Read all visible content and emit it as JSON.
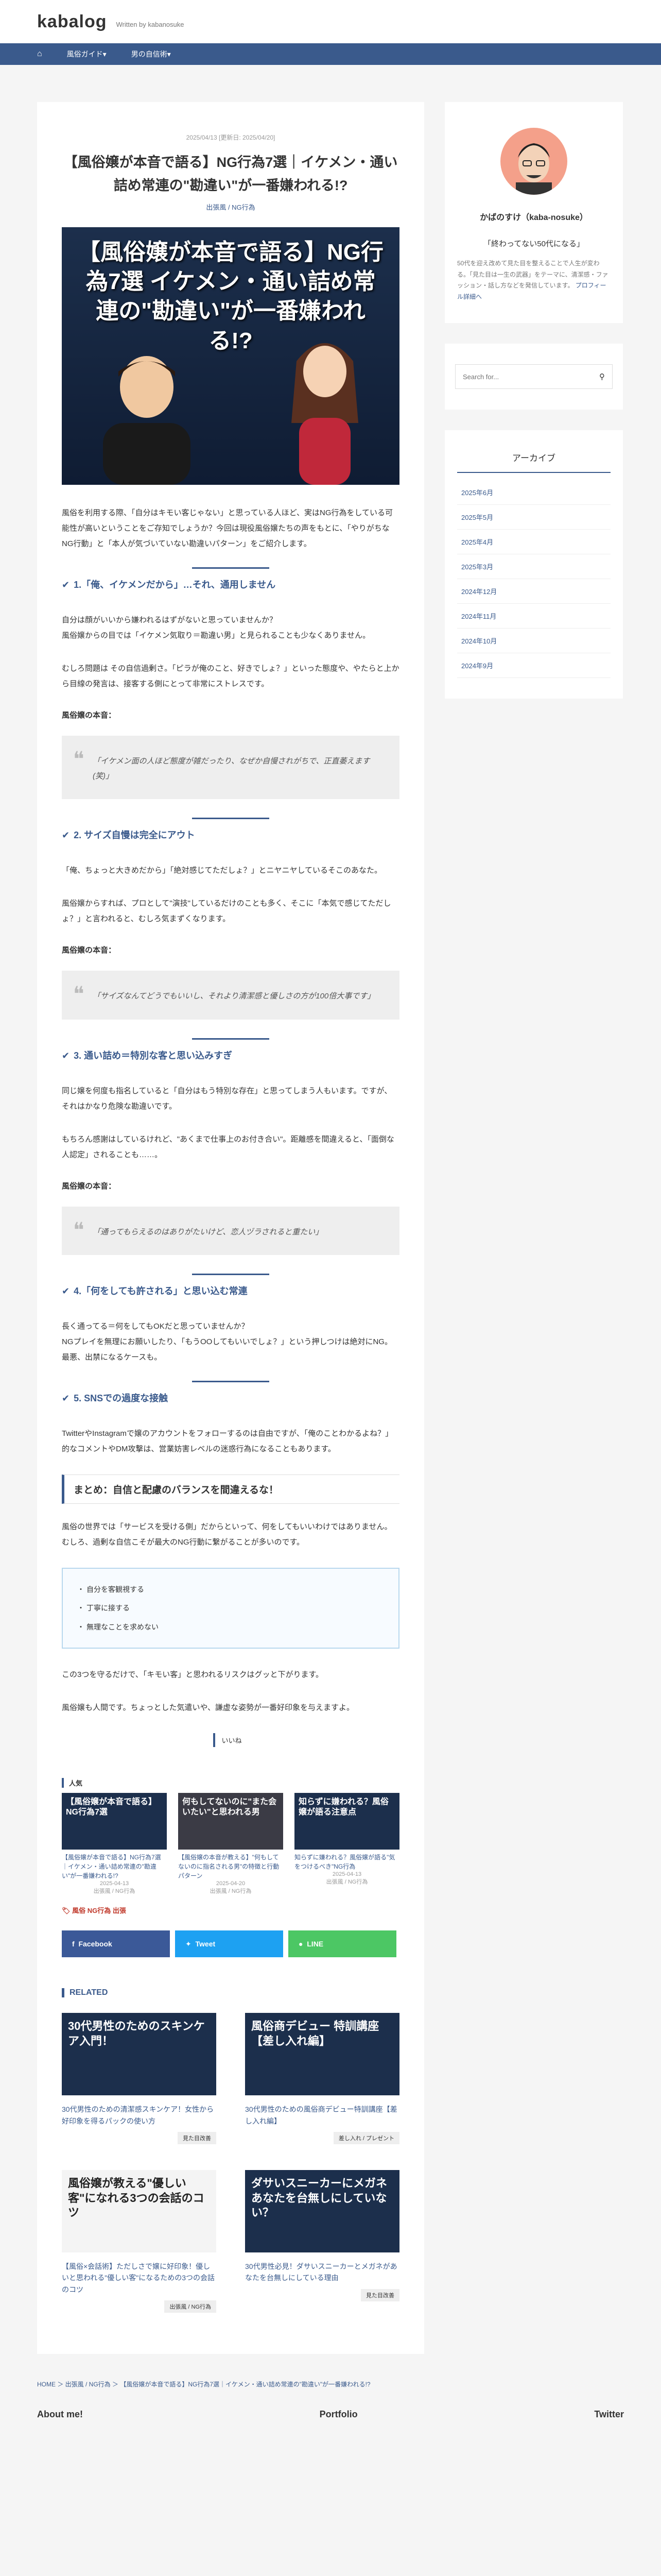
{
  "site": {
    "logo": "kabalog",
    "tagline": "Written by kabanosuke"
  },
  "nav": {
    "home_icon": "home-icon",
    "items": [
      "風俗ガイド▾",
      "男の自信術▾"
    ]
  },
  "article": {
    "meta": "2025/04/13 [更新日: 2025/04/20]",
    "title": "【風俗嬢が本音で語る】NG行為7選｜イケメン・通い詰め常連の\"勘違い\"が一番嫌われる!?",
    "category": "出張風 / NG行為",
    "eyecatch_title": "【風俗嬢が本音で語る】NG行為7選 イケメン・通い詰め常連の\"勘違い\"が一番嫌われる!?",
    "intro": "風俗を利用する際、「自分はキモい客じゃない」と思っている人ほど、実はNG行為をしている可能性が高いということをご存知でしょうか？今回は現役風俗嬢たちの声をもとに、「やりがちなNG行動」と「本人が気づいていない勘違いパターン」をご紹介します。",
    "sections": [
      {
        "heading": "1.「俺、イケメンだから」…それ、通用しません",
        "body1": "自分は顔がいいから嫌われるはずがないと思っていませんか？\n風俗嬢からの目では「イケメン気取り＝勘違い男」と見られることも少なくありません。",
        "body2": "むしろ問題は その自信過剰さ。「ピラが俺のこと、好きでしょ？」といった態度や、やたらと上から目線の発言は、接客する側にとって非常にストレスです。",
        "honne_label": "風俗嬢の本音：",
        "quote": "「イケメン面の人ほど態度が雑だったり、なぜか自慢されがちで、正直萎えます(笑)」"
      },
      {
        "heading": "2. サイズ自慢は完全にアウト",
        "body1": "「俺、ちょっと大きめだから」「絶対感じてただしょ？」とニヤニヤしているそこのあなた。",
        "body2": "風俗嬢からすれば、プロとして\"演技\"しているだけのことも多く、そこに「本気で感じてただしょ？」と言われると、むしろ気まずくなります。",
        "honne_label": "風俗嬢の本音：",
        "quote": "「サイズなんてどうでもいいし、それより清潔感と優しさの方が100倍大事です」"
      },
      {
        "heading": "3. 通い詰め＝特別な客と思い込みすぎ",
        "body1": "同じ嬢を何度も指名していると「自分はもう特別な存在」と思ってしまう人もいます。ですが、それはかなり危険な勘違いです。",
        "body2": "もちろん感謝はしているけれど、\"あくまで仕事上のお付き合い\"。距離感を間違えると、「面倒な人認定」されることも……。",
        "honne_label": "風俗嬢の本音：",
        "quote": "「通ってもらえるのはありがたいけど、恋人ヅラされると重たい」"
      },
      {
        "heading": "4.「何をしても許される」と思い込む常連",
        "body1": "長く通ってる＝何をしてもOKだと思っていませんか？\nNGプレイを無理にお願いしたり、「もうOOしてもいいでしょ？」という押しつけは絶対にNG。最悪、出禁になるケースも。"
      },
      {
        "heading": "5. SNSでの過度な接触",
        "body1": "TwitterやInstagramで嬢のアカウントをフォローするのは自由ですが、「俺のことわかるよね？」的なコメントやDM攻撃は、営業妨害レベルの迷惑行為になることもあります。"
      }
    ],
    "matome": {
      "heading": "まとめ：自信と配慮のバランスを間違えるな！",
      "body1": "風俗の世界では「サービスを受ける側」だからといって、何をしてもいいわけではありません。\nむしろ、過剰な自信こそが最大のNG行動に繋がることが多いのです。",
      "list": [
        "自分を客観視する",
        "丁寧に接する",
        "無理なことを求めない"
      ],
      "body2": "この3つを守るだけで、「キモい客」と思われるリスクはグッと下がります。",
      "body3": "風俗嬢も人間です。ちょっとした気遣いや、謙虚な姿勢が一番好印象を与えますよ。"
    },
    "iine": "いいね",
    "popular_head": "人気",
    "popular": [
      {
        "thumb": "【風俗嬢が本音で語る】NG行為7選",
        "title": "【風俗嬢が本音で語る】NG行為7選｜イケメン・通い詰め常連の\"勘違い\"が一番嫌われる!?",
        "date": "2025-04-13",
        "cat": "出張風 / NG行為"
      },
      {
        "thumb": "何もしてないのに\"また会いたい\"と思われる男",
        "title": "【風俗嬢の本音が教える】\"何もしてないのに指名される男\"の特徴と行動パターン",
        "date": "2025-04-20",
        "cat": "出張風 / NG行為"
      },
      {
        "thumb": "知らずに嫌われる？風俗嬢が語る注意点",
        "title": "知らずに嫌われる？風俗嬢が語る\"気をつけるべき\"NG行為",
        "date": "2025-04-13",
        "cat": "出張風 / NG行為"
      }
    ],
    "tag": "風俗 NG行為 出張",
    "share": [
      {
        "label": "Facebook",
        "color": "#3b5998"
      },
      {
        "label": "Tweet",
        "color": "#1da1f2"
      },
      {
        "label": "LINE",
        "color": "#4cc764"
      }
    ],
    "related_head": "RELATED",
    "related": [
      {
        "thumb": "30代男性のためのスキンケア入門！",
        "title": "30代男性のための清潔感スキンケア！女性から好印象を得るパックの使い方",
        "cat": "見た目改善"
      },
      {
        "thumb": "風俗商デビュー 特訓講座【差し入れ編】",
        "title": "30代男性のための風俗商デビュー特訓講座【差し入れ編】",
        "cat": "差し入れ / プレゼント"
      },
      {
        "thumb": "風俗嬢が教える\"優しい客\"になれる3つの会話のコツ",
        "title": "【風俗×会話術】ただしさで嬢に好印象！優しいと思われる\"優しい客\"になるための3つの会話のコツ",
        "cat": "出張風 / NG行為"
      },
      {
        "thumb": "ダサいスニーカーにメガネあなたを台無しにしていない？",
        "title": "30代男性必見！ダサいスニーカーとメガネがあなたを台無しにしている理由",
        "cat": "見た目改善"
      }
    ]
  },
  "sidebar": {
    "name": "かばのすけ（kaba-nosuke）",
    "catch": "「終わってない50代になる」",
    "desc": "50代を迎え改めて見た目を整えることで人生が変わる。「見た目は一生の武器」をテーマに、清潔感・ファッション・話し方などを発信しています。",
    "profile_link": "プロフィール詳細へ",
    "search_placeholder": "Search for...",
    "archive_title": "アーカイブ",
    "archives": [
      "2025年6月",
      "2025年5月",
      "2025年4月",
      "2025年3月",
      "2024年12月",
      "2024年11月",
      "2024年10月",
      "2024年9月"
    ]
  },
  "breadcrumb": "HOME ＞ 出張風 / NG行為 ＞ 【風俗嬢が本音で語る】NG行為7選｜イケメン・通い詰め常連の\"勘違い\"が一番嫌われる!?",
  "footer": {
    "about": "About me!",
    "portfolio": "Portfolio",
    "twitter": "Twitter"
  }
}
